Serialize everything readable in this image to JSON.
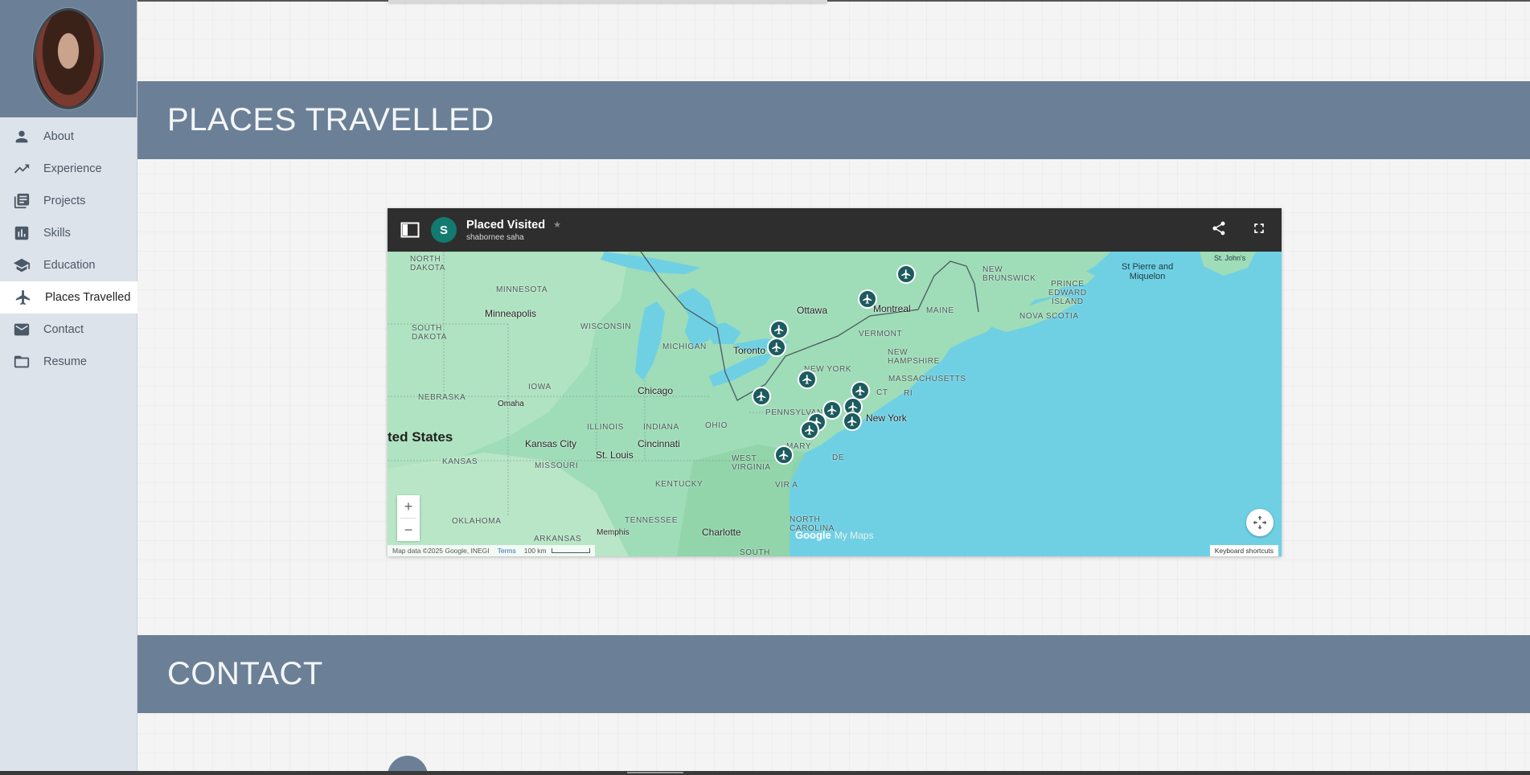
{
  "nav": {
    "items": [
      {
        "label": "About",
        "icon": "person-icon"
      },
      {
        "label": "Experience",
        "icon": "trending-up-icon"
      },
      {
        "label": "Projects",
        "icon": "library-books-icon"
      },
      {
        "label": "Skills",
        "icon": "bar-chart-icon"
      },
      {
        "label": "Education",
        "icon": "school-icon"
      },
      {
        "label": "Places Travelled",
        "icon": "airplane-icon",
        "active": true
      },
      {
        "label": "Contact",
        "icon": "mail-icon"
      },
      {
        "label": "Resume",
        "icon": "folder-icon"
      }
    ]
  },
  "sections": {
    "places": {
      "title": "PLACES TRAVELLED"
    },
    "contact": {
      "title": "CONTACT"
    }
  },
  "map": {
    "avatar_letter": "S",
    "title": "Placed Visited",
    "subtitle": "shabornee saha",
    "star": "★",
    "labels": {
      "north_dakota": "NORTH\nDAKOTA",
      "south_dakota": "SOUTH\nDAKOTA",
      "minnesota": "MINNESOTA",
      "wisconsin": "WISCONSIN",
      "michigan": "MICHIGAN",
      "iowa": "IOWA",
      "nebraska": "NEBRASKA",
      "illinois": "ILLINOIS",
      "indiana": "INDIANA",
      "ohio": "OHIO",
      "kansas": "KANSAS",
      "missouri": "MISSOURI",
      "kentucky": "KENTUCKY",
      "west_virginia": "WEST\nVIRGINIA",
      "tennessee": "TENNESSEE",
      "oklahoma": "OKLAHOMA",
      "arkansas": "ARKANSAS",
      "north_carolina": "NORTH\nCAROLINA",
      "south": "SOUTH",
      "pennsylvania": "PENNSYLVANIA",
      "new_york": "NEW YORK",
      "vermont": "VERMONT",
      "new_hampshire": "NEW\nHAMPSHIRE",
      "massachusetts": "MASSACHUSETTS",
      "ct": "CT",
      "ri": "RI",
      "maine": "MAINE",
      "new_brunswick": "NEW\nBRUNSWICK",
      "prince_edward_island": "PRINCE\nEDWARD\nISLAND",
      "nova_scotia": "NOVA SCOTIA",
      "maryland": "MARY",
      "de": "DE",
      "virginia": "VIR    A"
    },
    "cities": {
      "minneapolis": "Minneapolis",
      "omaha": "Omaha",
      "chicago": "Chicago",
      "kansas_city": "Kansas City",
      "st_louis": "St. Louis",
      "cincinnati": "Cincinnati",
      "memphis": "Memphis",
      "charlotte": "Charlotte",
      "toronto": "Toronto",
      "ottawa": "Ottawa",
      "montreal": "Montreal",
      "new_york_city": "New York",
      "st_pierre": "St Pierre and\nMiquelon",
      "st_johns": "St. John's",
      "united_states": "ted States"
    },
    "brand": "Google",
    "brand_suffix": "My Maps",
    "attribution": "Map data ©2025 Google, INEGI",
    "terms": "Terms",
    "scale": "100 km",
    "keyboard": "Keyboard shortcuts",
    "zoom_in": "+",
    "zoom_out": "−"
  }
}
